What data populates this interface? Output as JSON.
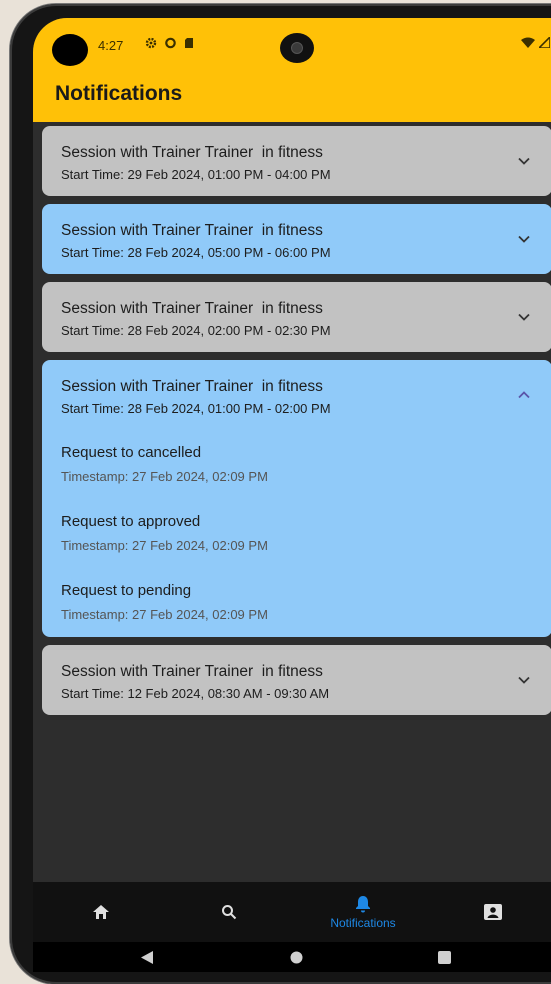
{
  "status_bar": {
    "time": "4:27"
  },
  "header": {
    "title": "Notifications"
  },
  "notifications": [
    {
      "title": "Session with Trainer Trainer  in fitness",
      "start_time": "Start Time: 29 Feb 2024, 01:00 PM - 04:00 PM",
      "color": "#c2c2c2",
      "expanded": false
    },
    {
      "title": "Session with Trainer Trainer  in fitness",
      "start_time": "Start Time: 28 Feb 2024, 05:00 PM - 06:00 PM",
      "color": "#90caf9",
      "expanded": false
    },
    {
      "title": "Session with Trainer Trainer  in fitness",
      "start_time": "Start Time: 28 Feb 2024, 02:00 PM - 02:30 PM",
      "color": "#c2c2c2",
      "expanded": false
    },
    {
      "title": "Session with Trainer Trainer  in fitness",
      "start_time": "Start Time: 28 Feb 2024, 01:00 PM - 02:00 PM",
      "color": "#90caf9",
      "expanded": true,
      "history": [
        {
          "status": "Request to cancelled",
          "timestamp": "Timestamp: 27 Feb 2024, 02:09 PM"
        },
        {
          "status": "Request to approved",
          "timestamp": "Timestamp: 27 Feb 2024, 02:09 PM"
        },
        {
          "status": "Request to pending",
          "timestamp": "Timestamp: 27 Feb 2024, 02:09 PM"
        }
      ]
    },
    {
      "title": "Session with Trainer Trainer  in fitness",
      "start_time": "Start Time: 12 Feb 2024, 08:30 AM - 09:30 AM",
      "color": "#c2c2c2",
      "expanded": false
    }
  ],
  "bottom_nav": {
    "items": [
      {
        "icon": "home-icon",
        "label": ""
      },
      {
        "icon": "search-icon",
        "label": ""
      },
      {
        "icon": "bell-icon",
        "label": "Notifications",
        "active": true
      },
      {
        "icon": "profile-icon",
        "label": ""
      }
    ],
    "active_color": "#1e88e5"
  },
  "colors": {
    "app_bar": "#ffc107",
    "background": "#2d2d2d",
    "chevron_expanded": "#5a55a8"
  }
}
